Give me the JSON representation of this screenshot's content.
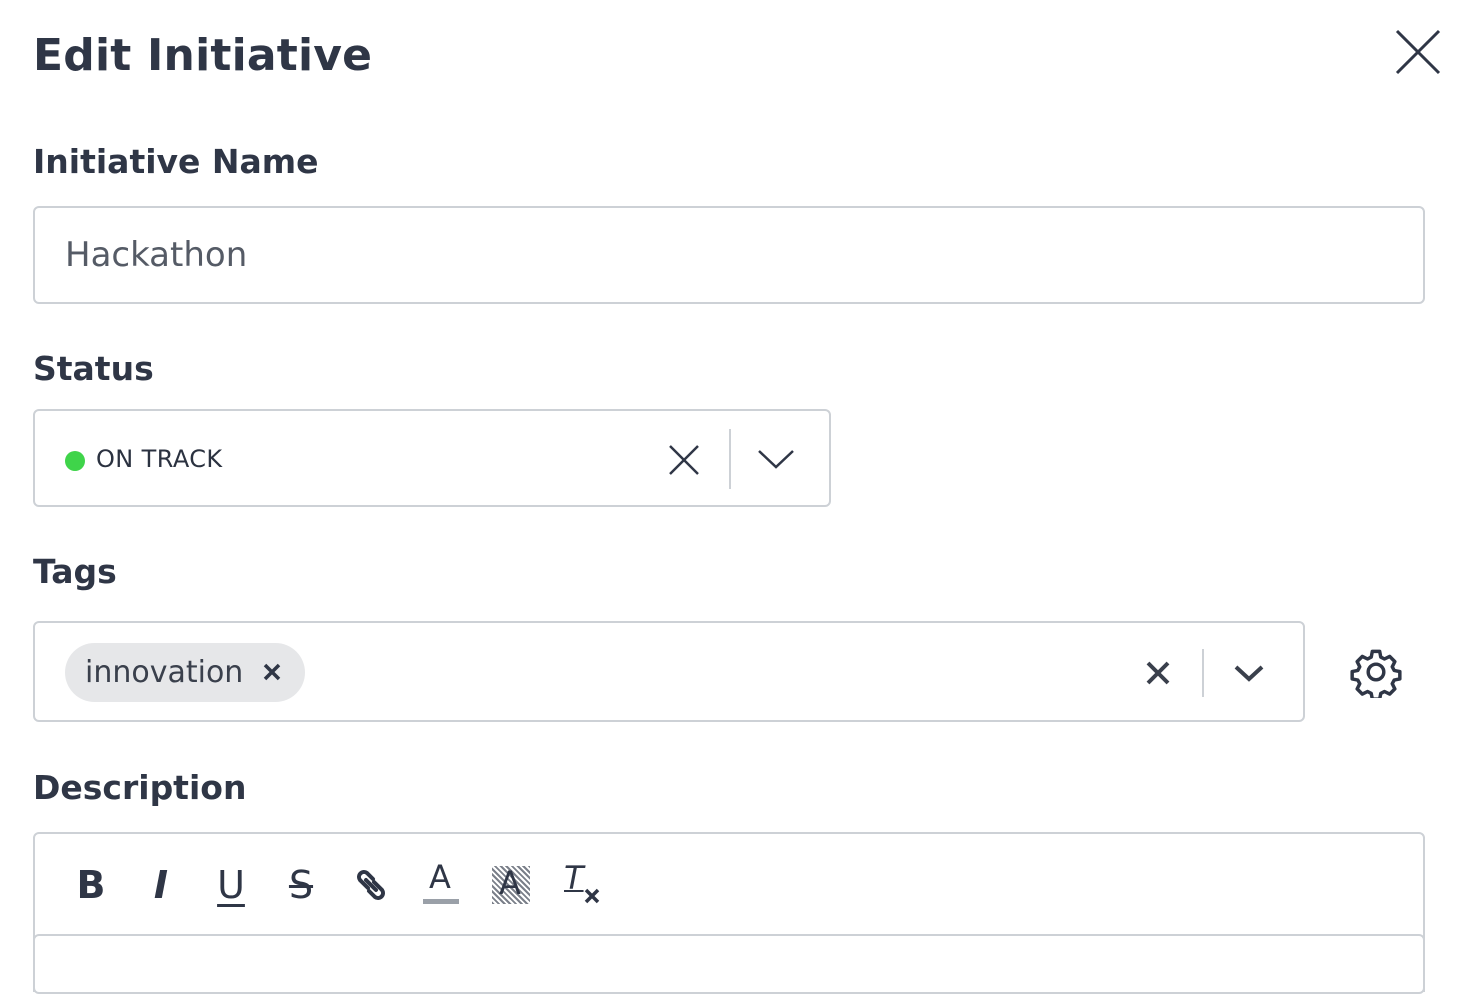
{
  "dialog": {
    "title": "Edit Initiative"
  },
  "fields": {
    "name": {
      "label": "Initiative Name",
      "value": "Hackathon"
    },
    "status": {
      "label": "Status",
      "value": "ON TRACK",
      "dot_color": "#3fd44a"
    },
    "tags": {
      "label": "Tags",
      "chips": [
        {
          "label": "innovation"
        }
      ]
    },
    "description": {
      "label": "Description"
    }
  },
  "toolbar": {
    "bold": "B",
    "italic": "I",
    "underline": "U",
    "strike": "S",
    "font_color": "A",
    "highlight": "A",
    "clear": "T"
  },
  "colors": {
    "text": "#2f3646",
    "border": "#cdd1d6",
    "chip_bg": "#e6e7e9",
    "status_green": "#3fd44a"
  }
}
